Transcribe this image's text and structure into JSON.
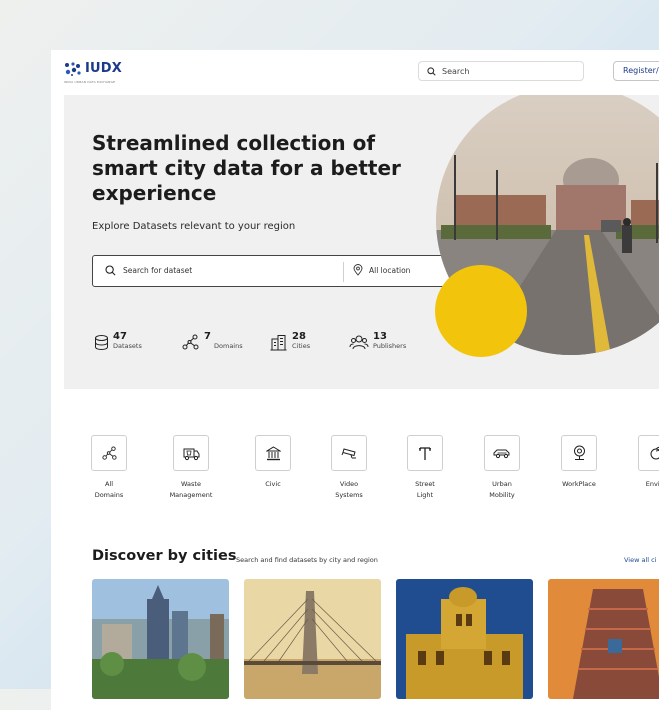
{
  "header": {
    "logo_text": "IUDX",
    "logo_subtext": "INDIA URBAN DATA EXCHANGE",
    "search_placeholder": "Search",
    "register_label": "Register/L"
  },
  "hero": {
    "title": "Streamlined collection of smart city data for a better experience",
    "subtitle": "Explore Datasets relevant to your region",
    "search_placeholder": "Search for dataset",
    "location_value": "All location",
    "stats": [
      {
        "value": "47",
        "label": "Datasets",
        "icon": "database-icon"
      },
      {
        "value": "7",
        "label": "Domains",
        "icon": "network-icon"
      },
      {
        "value": "28",
        "label": "Cities",
        "icon": "buildings-icon"
      },
      {
        "value": "13",
        "label": "Publishers",
        "icon": "users-icon"
      }
    ]
  },
  "domains": [
    {
      "line1": "All",
      "line2": "Domains",
      "icon": "network-icon"
    },
    {
      "line1": "Waste",
      "line2": "Management",
      "icon": "garbage-truck-icon"
    },
    {
      "line1": "Civic",
      "line2": "",
      "icon": "civic-building-icon"
    },
    {
      "line1": "Video",
      "line2": "Systems",
      "icon": "cctv-camera-icon"
    },
    {
      "line1": "Street",
      "line2": "Light",
      "icon": "street-light-icon"
    },
    {
      "line1": "Urban",
      "line2": "Mobility",
      "icon": "car-icon"
    },
    {
      "line1": "WorkPlace",
      "line2": "",
      "icon": "location-badge-icon"
    },
    {
      "line1": "Enviro",
      "line2": "",
      "icon": "environment-icon"
    }
  ],
  "cities": {
    "title": "Discover by cities",
    "subtitle": "Search and find datasets by city and region",
    "view_all": "View all ci"
  },
  "colors": {
    "brand_blue": "#1b4b8c",
    "accent_yellow": "#f2c50c",
    "hero_bg": "#f0f0f0"
  }
}
